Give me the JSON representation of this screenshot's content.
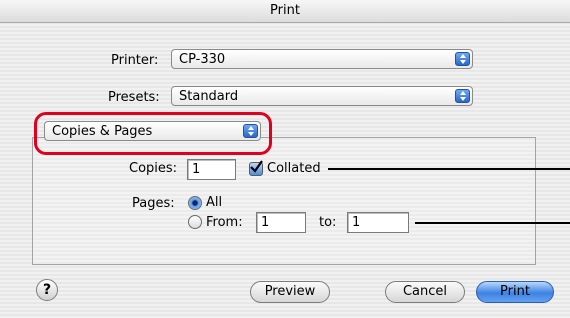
{
  "window": {
    "title": "Print"
  },
  "printer": {
    "label": "Printer:",
    "value": "CP-330"
  },
  "presets": {
    "label": "Presets:",
    "value": "Standard"
  },
  "section_popup": {
    "value": "Copies & Pages"
  },
  "copies": {
    "label": "Copies:",
    "value": "1",
    "collated_label": "Collated",
    "collated_checked": true
  },
  "pages": {
    "label": "Pages:",
    "all_label": "All",
    "from_label": "From:",
    "from_value": "1",
    "to_label": "to:",
    "to_value": "1",
    "selected": "all"
  },
  "buttons": {
    "help": "?",
    "preview": "Preview",
    "cancel": "Cancel",
    "print": "Print"
  },
  "colors": {
    "accent": "#3d82e3",
    "highlight_ring": "#e0001d"
  }
}
